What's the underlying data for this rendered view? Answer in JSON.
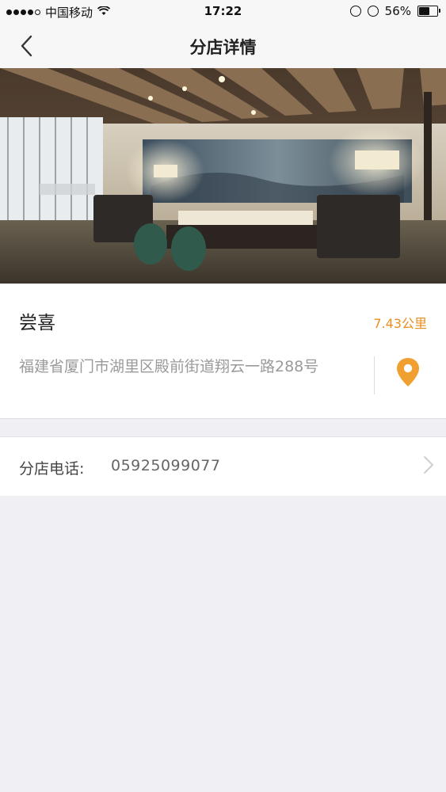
{
  "status_bar": {
    "carrier": "中国移动",
    "time": "17:22",
    "battery": "56%",
    "battery_level": 0.56
  },
  "nav": {
    "title": "分店详情",
    "back_icon": "chevron-left-icon"
  },
  "store": {
    "name": "尝喜",
    "distance": "7.43公里",
    "address": "福建省厦门市湖里区殿前街道翔云一路288号",
    "location_icon": "location-pin-icon"
  },
  "phone": {
    "label": "分店电话:",
    "value": "05925099077",
    "chevron_icon": "chevron-right-icon"
  },
  "colors": {
    "accent": "#f0a030",
    "distance": "#e98e21",
    "background": "#efeff4"
  }
}
